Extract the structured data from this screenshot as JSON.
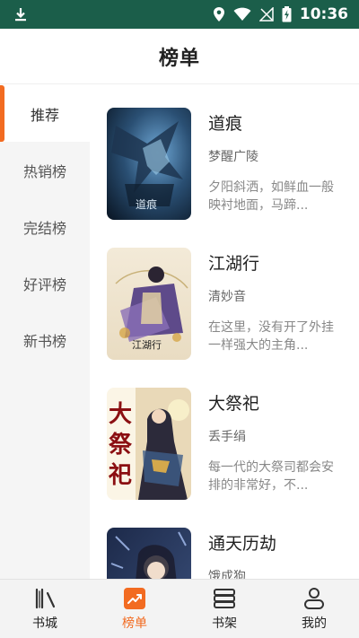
{
  "status_bar": {
    "time": "10:36"
  },
  "header": {
    "title": "榜单"
  },
  "side_nav": {
    "items": [
      {
        "label": "推荐",
        "active": true
      },
      {
        "label": "热销榜",
        "active": false
      },
      {
        "label": "完结榜",
        "active": false
      },
      {
        "label": "好评榜",
        "active": false
      },
      {
        "label": "新书榜",
        "active": false
      }
    ]
  },
  "books": [
    {
      "title": "道痕",
      "author": "梦醒广陵",
      "desc": "夕阳斜洒，如鲜血一般映衬地面，马蹄..."
    },
    {
      "title": "江湖行",
      "author": "清妙音",
      "desc": "在这里，没有开了外挂一样强大的主角..."
    },
    {
      "title": "大祭祀",
      "author": "丢手绢",
      "desc": "每一代的大祭司都会安排的非常好，不..."
    },
    {
      "title": "通天历劫",
      "author": "饿成狗",
      "desc": ""
    }
  ],
  "covers": {
    "cover1_text": "道痕",
    "cover2_text": "江湖行",
    "cover3_text": "大祭祀"
  },
  "bottom_nav": {
    "tabs": [
      {
        "label": "书城",
        "icon": "bookshelf-books-icon"
      },
      {
        "label": "榜单",
        "icon": "chart-trend-icon"
      },
      {
        "label": "书架",
        "icon": "stacked-books-icon"
      },
      {
        "label": "我的",
        "icon": "user-profile-icon"
      }
    ]
  },
  "colors": {
    "accent": "#f26b21",
    "status_bar": "#1b5e4a"
  }
}
